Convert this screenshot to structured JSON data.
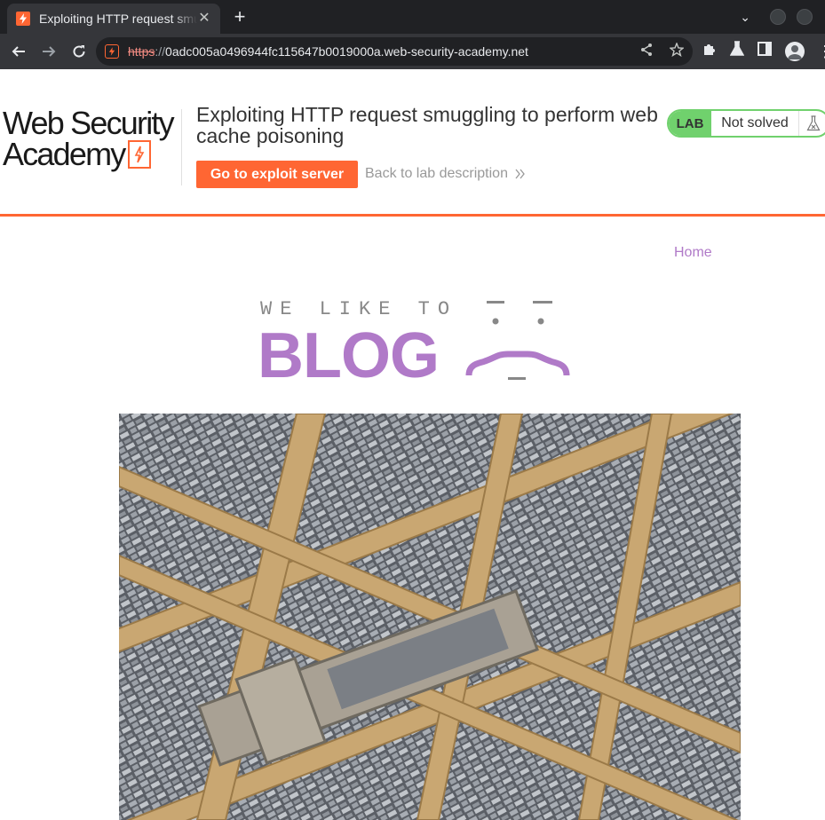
{
  "browser": {
    "tab_title": "Exploiting HTTP request smuggling to perform web cache poisoning",
    "url_scheme": "https",
    "url_sep": "://",
    "url_host": "0adc005a0496944fc115647b0019000a.web-security-academy.net"
  },
  "lab": {
    "logo_line1": "Web Security",
    "logo_line2": "Academy",
    "title": "Exploiting HTTP request smuggling to perform web cache poisoning",
    "exploit_button": "Go to exploit server",
    "back_link": "Back to lab description",
    "badge": "LAB",
    "status": "Not solved"
  },
  "blog": {
    "nav_home": "Home",
    "tagline": "WE LIKE TO",
    "wordmark": "BLOG"
  },
  "colors": {
    "accent": "#ff6633",
    "solved_green": "#70d16d",
    "blog_purple": "#b07ac8"
  }
}
